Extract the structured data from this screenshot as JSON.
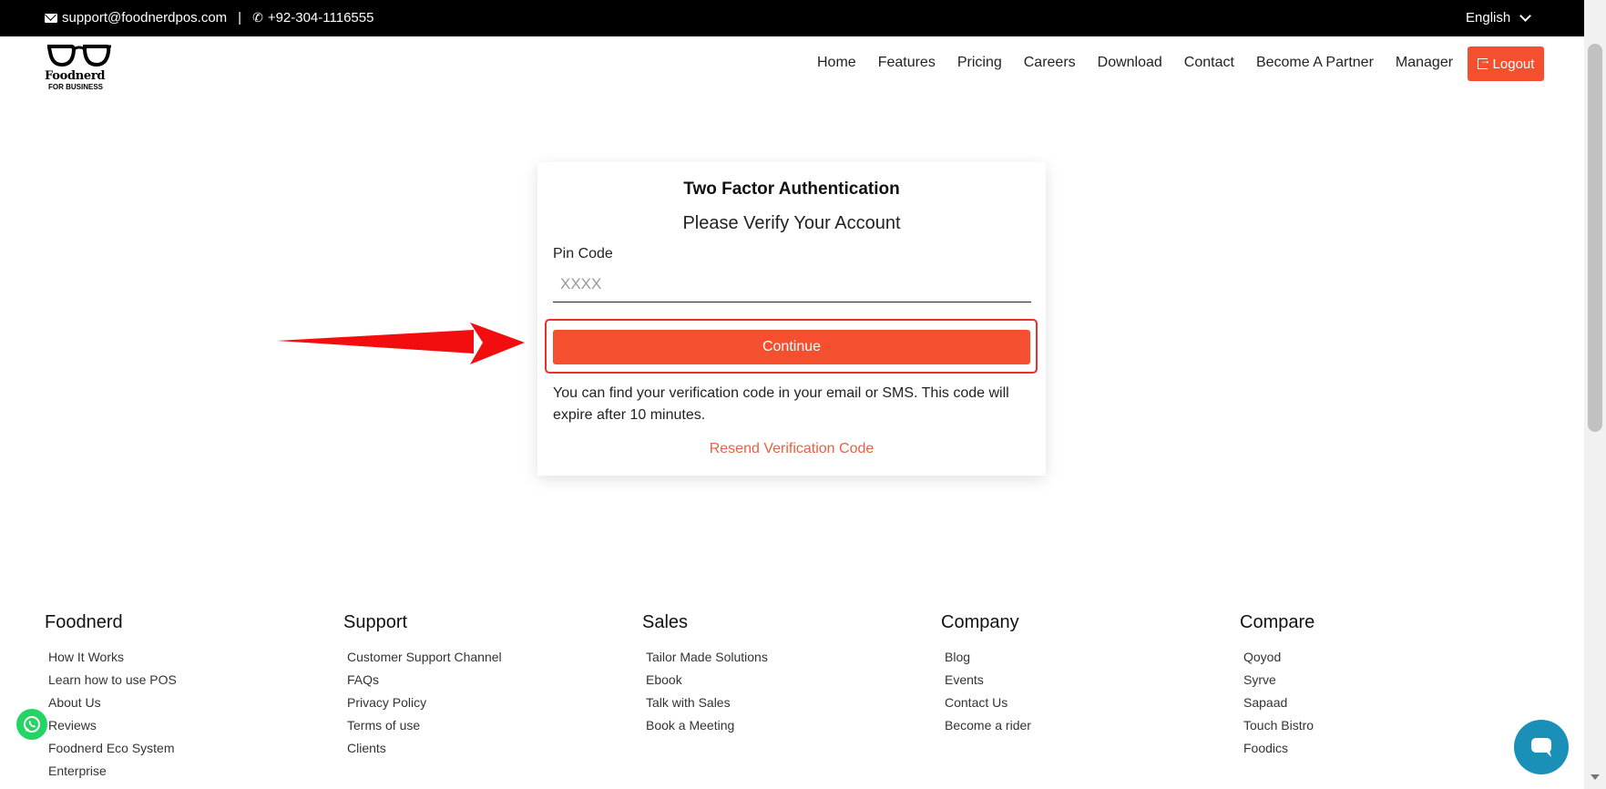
{
  "topbar": {
    "email": "support@foodnerdpos.com",
    "separator": "|",
    "phone": "+92-304-1116555",
    "language": "English"
  },
  "logo": {
    "name": "Foodnerd",
    "subtitle": "FOR BUSINESS"
  },
  "nav": {
    "items": [
      "Home",
      "Features",
      "Pricing",
      "Careers",
      "Download",
      "Contact",
      "Become A Partner",
      "Manager"
    ],
    "logout_label": "Logout"
  },
  "auth": {
    "title": "Two Factor Authentication",
    "subtitle": "Please Verify Your Account",
    "pin_label": "Pin Code",
    "pin_placeholder": "XXXX",
    "pin_value": "",
    "continue_label": "Continue",
    "info": "You can find your verification code in your email or SMS. This code will expire after 10 minutes.",
    "resend_label": "Resend Verification Code"
  },
  "footer": {
    "columns": [
      {
        "heading": "Foodnerd",
        "links": [
          "How It Works",
          "Learn how to use POS",
          "About Us",
          "Reviews",
          "Foodnerd Eco System",
          "Enterprise"
        ]
      },
      {
        "heading": "Support",
        "links": [
          "Customer Support Channel",
          "FAQs",
          "Privacy Policy",
          "Terms of use",
          "Clients"
        ]
      },
      {
        "heading": "Sales",
        "links": [
          "Tailor Made Solutions",
          "Ebook",
          "Talk with Sales",
          "Book a Meeting"
        ]
      },
      {
        "heading": "Company",
        "links": [
          "Blog",
          "Events",
          "Contact Us",
          "Become a rider"
        ]
      },
      {
        "heading": "Compare",
        "links": [
          "Qoyod",
          "Syrve",
          "Sapaad",
          "Touch Bistro",
          "Foodics"
        ]
      }
    ]
  },
  "colors": {
    "accent": "#f4502f",
    "highlight": "#e8312a",
    "resend": "#e8623f",
    "topbar": "#000000"
  },
  "icons": [
    "envelope-icon",
    "phone-icon",
    "chevron-down-icon",
    "logout-icon",
    "whatsapp-icon",
    "chat-icon",
    "glasses-logo-icon"
  ]
}
